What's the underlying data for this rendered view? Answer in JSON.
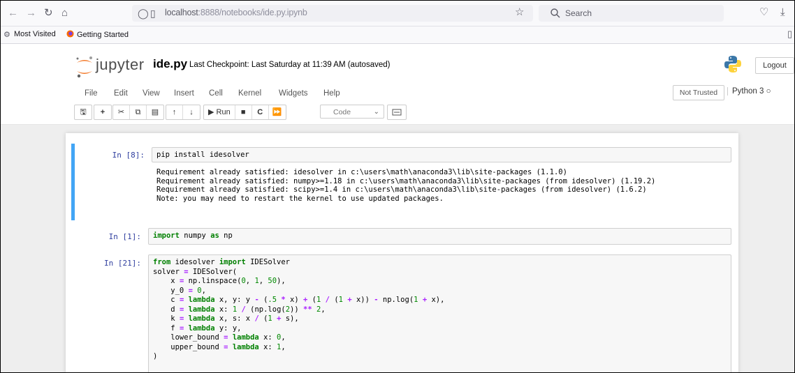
{
  "browser": {
    "url_host": "localhost",
    "url_rest": ":8888/notebooks/ide.py.ipynb",
    "search_placeholder": "Search"
  },
  "bookmarks": [
    {
      "label": "Most Visited",
      "icon": "gear-icon"
    },
    {
      "label": "Getting Started",
      "icon": "firefox-icon"
    }
  ],
  "jupyter": {
    "logo_text": "jupyter",
    "notebook_name": "ide.py",
    "checkpoint": "Last Checkpoint: Last Saturday at 11:39 AM  (autosaved)",
    "logout_label": "Logout",
    "menu": [
      "File",
      "Edit",
      "View",
      "Insert",
      "Cell",
      "Kernel",
      "Widgets",
      "Help"
    ],
    "trust_label": "Not Trusted",
    "kernel_label": "Python 3",
    "toolbar": {
      "run_label": "Run",
      "cell_type": "Code"
    }
  },
  "cells": [
    {
      "prompt": "In [8]:",
      "source": "pip install idesolver",
      "output": [
        "Requirement already satisfied: idesolver in c:\\users\\math\\anaconda3\\lib\\site-packages (1.1.0)",
        "Requirement already satisfied: numpy>=1.18 in c:\\users\\math\\anaconda3\\lib\\site-packages (from idesolver) (1.19.2)",
        "Requirement already satisfied: scipy>=1.4 in c:\\users\\math\\anaconda3\\lib\\site-packages (from idesolver) (1.6.2)",
        "Note: you may need to restart the kernel to use updated packages."
      ]
    },
    {
      "prompt": "In [1]:",
      "source": "import numpy as np"
    },
    {
      "prompt": "In [21]:",
      "source_lines": [
        "from idesolver import IDESolver",
        "solver = IDESolver(",
        "    x = np.linspace(0, 1, 50),",
        "    y_0 = 0,",
        "    c = lambda x, y: y - (.5 * x) + (1 / (1 + x)) - np.log(1 + x),",
        "    d = lambda x: 1 / (np.log(2)) ** 2,",
        "    k = lambda x, s: x / (1 + s),",
        "    f = lambda y: y,",
        "    lower_bound = lambda x: 0,",
        "    upper_bound = lambda x: 1,",
        ")"
      ]
    }
  ]
}
